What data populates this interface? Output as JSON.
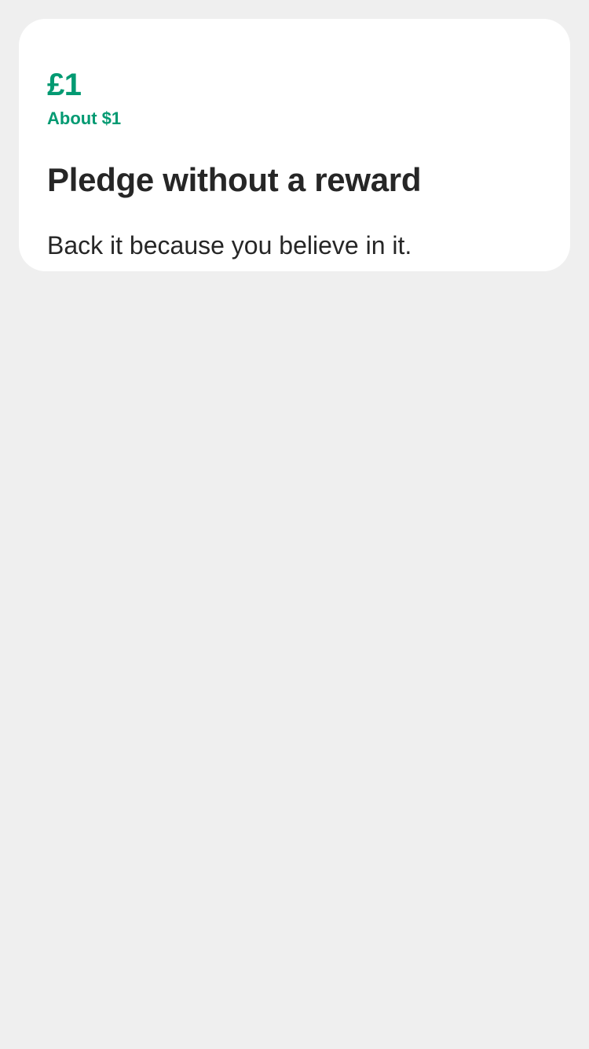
{
  "reward_card": {
    "amount": "£1",
    "converted_amount": "About $1",
    "title": "Pledge without a reward",
    "description": "Back it because you believe in it."
  },
  "colors": {
    "background": "#efefef",
    "card": "#ffffff",
    "accent": "#029a72",
    "text": "#262626"
  }
}
